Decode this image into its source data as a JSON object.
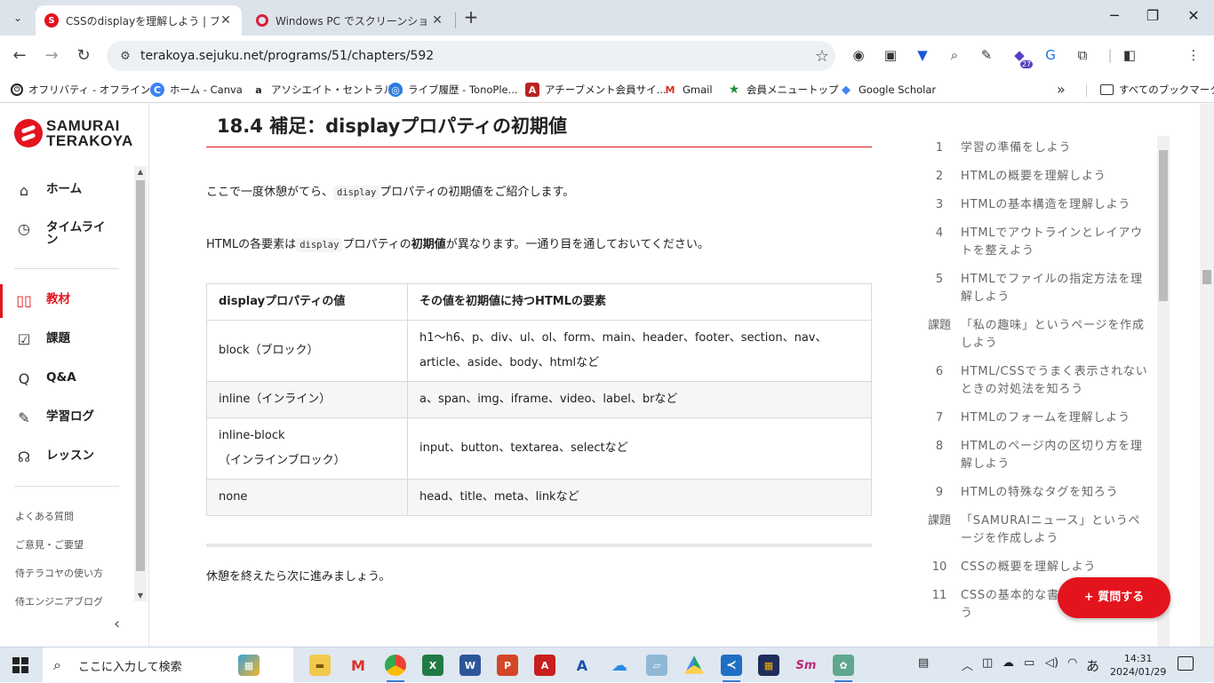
{
  "browser": {
    "tabs": [
      {
        "title": "CSSのdisplayを理解しよう | プログラ",
        "active": true
      },
      {
        "title": "Windows PC でスクリーンショットを",
        "active": false
      }
    ],
    "url": "terakoya.sejuku.net/programs/51/chapters/592",
    "bookmarks": [
      "オフリバティ - オフライン...",
      "ホーム - Canva",
      "アソシエイト・セントラル...",
      "ライブ履歴 - TonoPle...",
      "アチーブメント会員サイ...",
      "Gmail",
      "会員メニュートップ",
      "Google Scholar"
    ],
    "all_bookmarks": "すべてのブックマーク",
    "extension_badge": "27"
  },
  "sidebar": {
    "logo_line1": "SAMURAI",
    "logo_line2": "TERAKOYA",
    "nav": [
      {
        "label": "ホーム",
        "icon": "home-icon"
      },
      {
        "label": "タイムライン",
        "icon": "clock-icon"
      },
      {
        "label": "教材",
        "icon": "book-icon"
      },
      {
        "label": "課題",
        "icon": "task-icon"
      },
      {
        "label": "Q&A",
        "icon": "search-icon"
      },
      {
        "label": "学習ログ",
        "icon": "pencil-icon"
      },
      {
        "label": "レッスン",
        "icon": "headset-icon"
      }
    ],
    "links": [
      "よくある質問",
      "ご意見・ご要望",
      "侍テラコヤの使い方",
      "侍エンジニアブログ"
    ]
  },
  "article": {
    "heading": "18.4 補足：displayプロパティの初期値",
    "para1_before": "ここで一度休憩がてら、",
    "para1_code": "display",
    "para1_after": "プロパティの初期値をご紹介します。",
    "para2_a": "HTMLの各要素は",
    "para2_code": "display",
    "para2_b": "プロパティの",
    "para2_bold": "初期値",
    "para2_c": "が異なります。一通り目を通しておいてください。",
    "table": {
      "headers": [
        "displayプロパティの値",
        "その値を初期値に持つHTMLの要素"
      ],
      "rows": [
        [
          "block（ブロック）",
          "h1〜h6、p、div、ul、ol、form、main、header、footer、section、nav、article、aside、body、htmlなど"
        ],
        [
          "inline（インライン）",
          "a、span、img、iframe、video、label、brなど"
        ],
        [
          "inline-block（インラインブロック）",
          "input、button、textarea、selectなど"
        ],
        [
          "none",
          "head、title、meta、linkなど"
        ]
      ],
      "row3_line1": "inline-block",
      "row3_line2": "（インラインブロック）",
      "row1_line1": "h1〜h6、p、div、ul、ol、form、main、header、footer、section、nav、",
      "row1_line2": "article、aside、body、htmlなど"
    },
    "closing": "休憩を終えたら次に進みましょう。"
  },
  "toc": [
    {
      "num": "1",
      "title": "学習の準備をしよう"
    },
    {
      "num": "2",
      "title": "HTMLの概要を理解しよう"
    },
    {
      "num": "3",
      "title": "HTMLの基本構造を理解しよう"
    },
    {
      "num": "4",
      "title": "HTMLでアウトラインとレイアウトを整えよう"
    },
    {
      "num": "5",
      "title": "HTMLでファイルの指定方法を理解しよう"
    },
    {
      "num": "課題",
      "title": "「私の趣味」というページを作成しよう"
    },
    {
      "num": "6",
      "title": "HTML/CSSでうまく表示されないときの対処法を知ろう"
    },
    {
      "num": "7",
      "title": "HTMLのフォームを理解しよう"
    },
    {
      "num": "8",
      "title": "HTMLのページ内の区切り方を理解しよう"
    },
    {
      "num": "9",
      "title": "HTMLの特殊なタグを知ろう"
    },
    {
      "num": "課題",
      "title": "「SAMURAIニュース」というページを作成しよう"
    },
    {
      "num": "10",
      "title": "CSSの概要を理解しよう"
    },
    {
      "num": "11",
      "title": "CSSの基本的な書き方を理解しよう"
    }
  ],
  "ask_button": "+ 質問する",
  "taskbar": {
    "search_placeholder": "ここに入力して検索",
    "ime": "あ",
    "time": "14:31",
    "date": "2024/01/29"
  },
  "colors": {
    "brand_red": "#e4141e",
    "tab_bar": "#dde3ea"
  }
}
